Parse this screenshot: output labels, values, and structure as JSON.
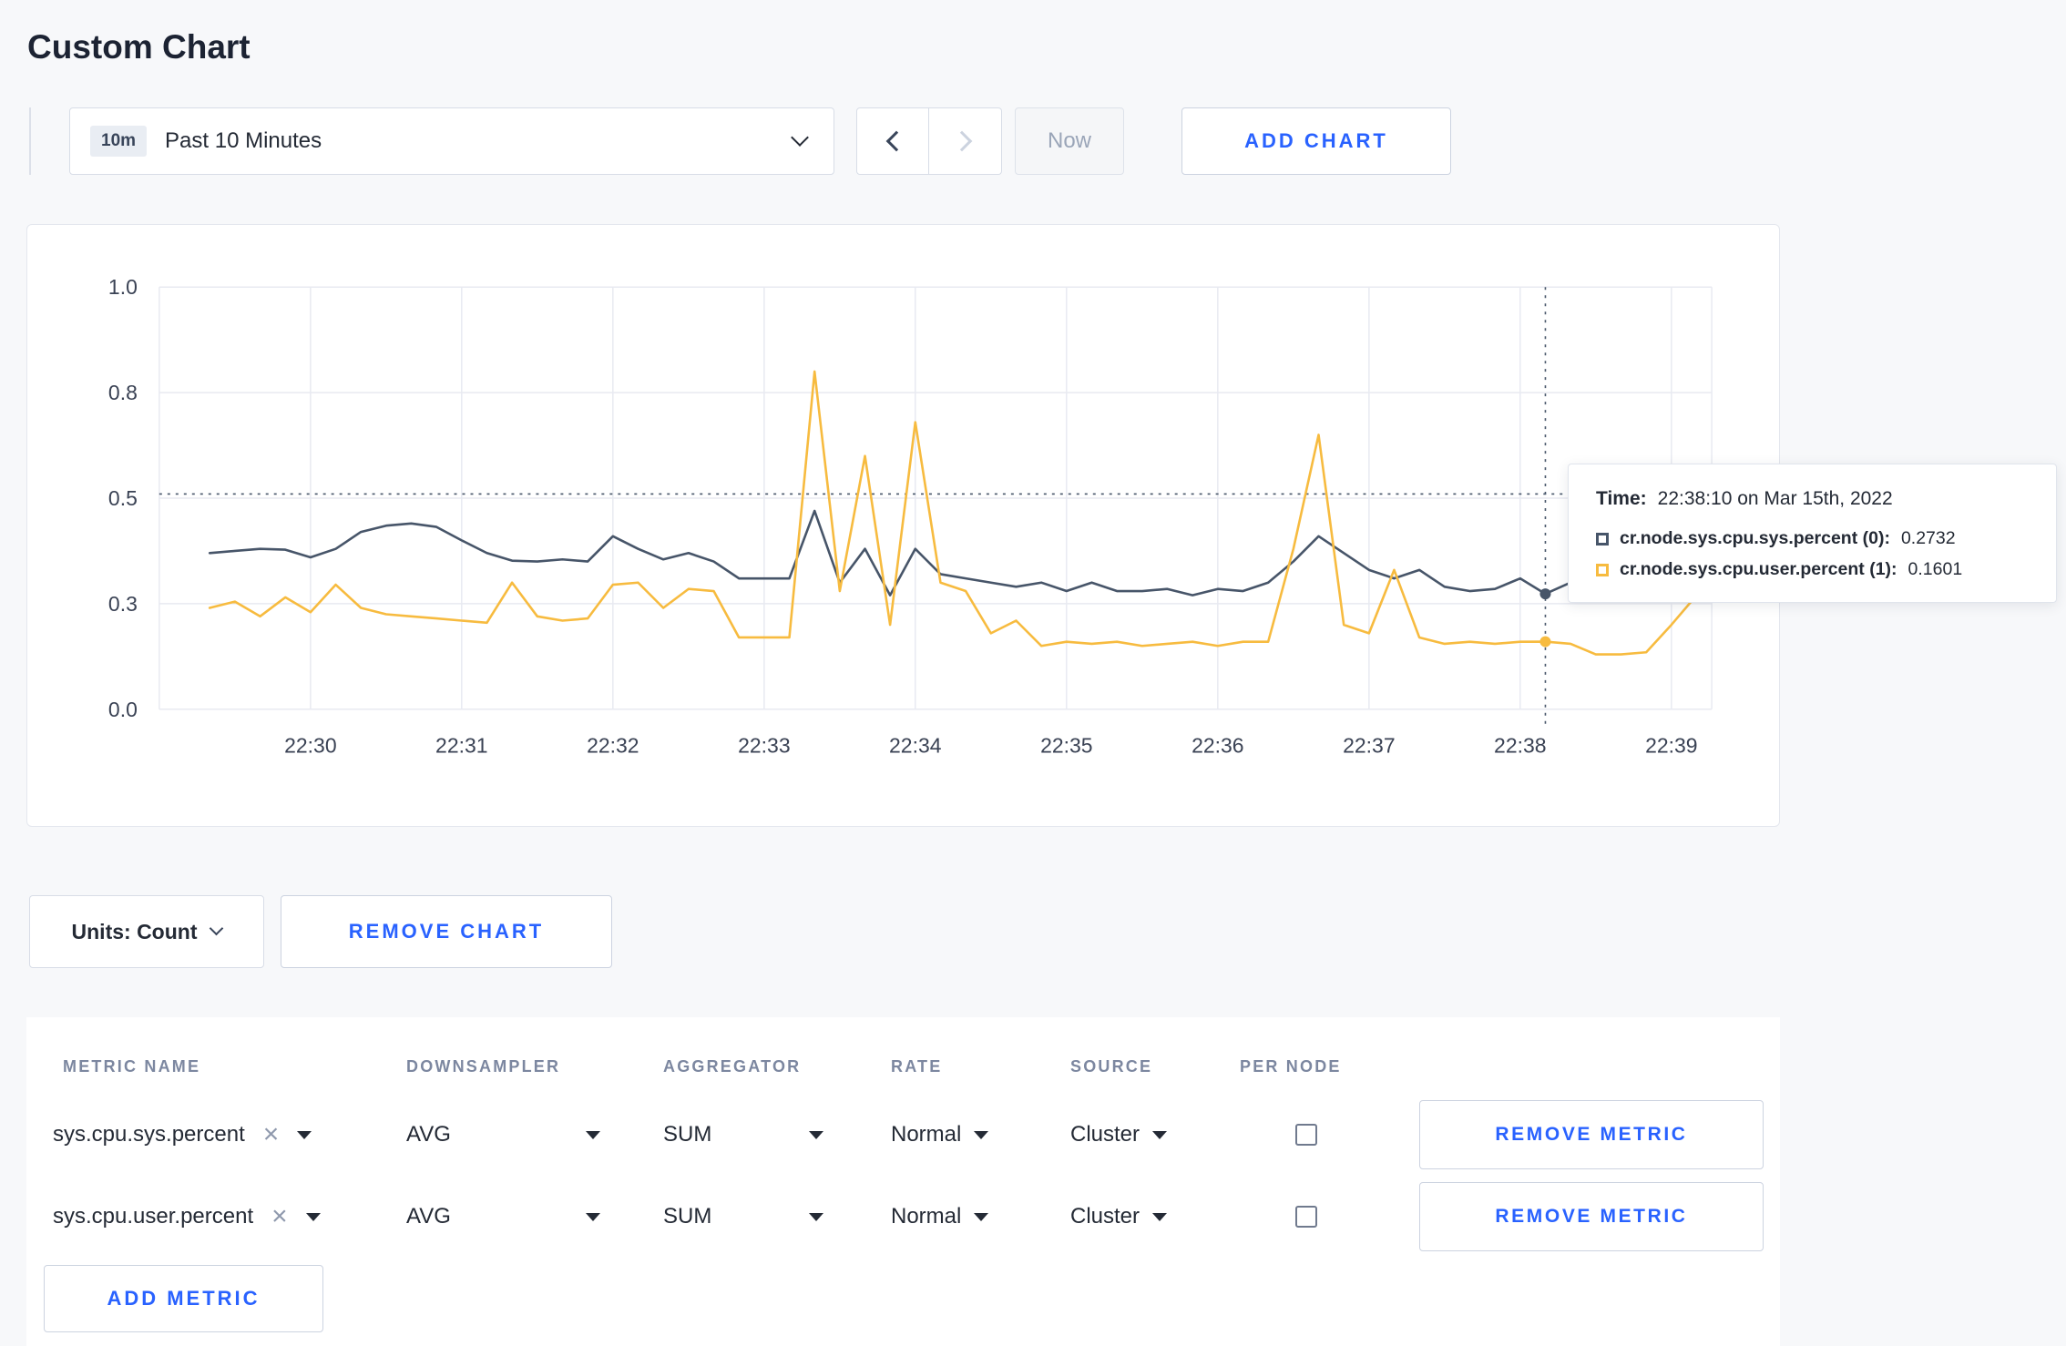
{
  "page": {
    "title": "Custom Chart"
  },
  "colors": {
    "accent_blue": "#2962ff",
    "series_sys": "#475569",
    "series_user": "#f7bb3f",
    "grid": "#e8eaf1"
  },
  "icons": {
    "close": "×",
    "chevron_down": "css-chevron-down",
    "chevron_left": "css-chevron-left",
    "chevron_right": "css-chevron-right",
    "caret_down": "css-triangle-down",
    "checkbox_unchecked": "css-box"
  },
  "toolbar": {
    "time_range": {
      "badge": "10m",
      "label": "Past 10 Minutes"
    },
    "now_label": "Now",
    "add_chart_label": "ADD CHART"
  },
  "chart_controls": {
    "units_label": "Units: Count",
    "remove_chart_label": "REMOVE CHART"
  },
  "tooltip": {
    "time_label": "Time:",
    "time_value": "22:38:10 on Mar 15th, 2022",
    "series": [
      {
        "label": "cr.node.sys.cpu.sys.percent (0):",
        "value": "0.2732"
      },
      {
        "label": "cr.node.sys.cpu.user.percent (1):",
        "value": "0.1601"
      }
    ]
  },
  "chart_data": {
    "type": "line",
    "title": "",
    "xlabel": "",
    "ylabel": "",
    "ylim": [
      0,
      1
    ],
    "grid": true,
    "legend_position": "tooltip",
    "x_domain": [
      0,
      616
    ],
    "x_unit": "seconds after 22:29:00",
    "y_ticks": [
      {
        "v": 0.0,
        "label": "0.0"
      },
      {
        "v": 0.25,
        "label": "0.3"
      },
      {
        "v": 0.5,
        "label": "0.5"
      },
      {
        "v": 0.75,
        "label": "0.8"
      },
      {
        "v": 1.0,
        "label": "1.0"
      }
    ],
    "x_ticks": [
      {
        "t": 60,
        "label": "22:30"
      },
      {
        "t": 120,
        "label": "22:31"
      },
      {
        "t": 180,
        "label": "22:32"
      },
      {
        "t": 240,
        "label": "22:33"
      },
      {
        "t": 300,
        "label": "22:34"
      },
      {
        "t": 360,
        "label": "22:35"
      },
      {
        "t": 420,
        "label": "22:36"
      },
      {
        "t": 480,
        "label": "22:37"
      },
      {
        "t": 540,
        "label": "22:38"
      },
      {
        "t": 600,
        "label": "22:39"
      }
    ],
    "crosshair": {
      "t": 550,
      "y_value": 0.51,
      "time": "22:38:10"
    },
    "series": [
      {
        "name": "cr.node.sys.cpu.sys.percent",
        "color": "#475569",
        "t_start": 20,
        "t_step": 10,
        "values": [
          0.37,
          0.375,
          0.38,
          0.378,
          0.36,
          0.38,
          0.42,
          0.435,
          0.44,
          0.432,
          0.4,
          0.37,
          0.352,
          0.35,
          0.355,
          0.35,
          0.41,
          0.38,
          0.355,
          0.37,
          0.35,
          0.31,
          0.31,
          0.31,
          0.47,
          0.3,
          0.38,
          0.27,
          0.38,
          0.32,
          0.31,
          0.3,
          0.29,
          0.3,
          0.28,
          0.3,
          0.28,
          0.28,
          0.285,
          0.27,
          0.285,
          0.28,
          0.3,
          0.35,
          0.41,
          0.37,
          0.33,
          0.31,
          0.33,
          0.29,
          0.28,
          0.285,
          0.31,
          0.2732,
          0.3,
          0.29,
          0.28,
          0.29,
          0.3,
          0.29
        ]
      },
      {
        "name": "cr.node.sys.cpu.user.percent",
        "color": "#f7bb3f",
        "t_start": 20,
        "t_step": 10,
        "values": [
          0.24,
          0.255,
          0.22,
          0.265,
          0.23,
          0.295,
          0.24,
          0.225,
          0.22,
          0.215,
          0.21,
          0.205,
          0.3,
          0.22,
          0.21,
          0.215,
          0.295,
          0.3,
          0.24,
          0.285,
          0.28,
          0.17,
          0.17,
          0.17,
          0.8,
          0.28,
          0.6,
          0.2,
          0.68,
          0.3,
          0.28,
          0.18,
          0.21,
          0.15,
          0.16,
          0.155,
          0.16,
          0.15,
          0.155,
          0.16,
          0.15,
          0.16,
          0.16,
          0.38,
          0.65,
          0.2,
          0.18,
          0.33,
          0.17,
          0.155,
          0.16,
          0.155,
          0.16,
          0.1601,
          0.155,
          0.13,
          0.13,
          0.135,
          0.2,
          0.27
        ]
      }
    ]
  },
  "metrics_table": {
    "headers": [
      "METRIC NAME",
      "DOWNSAMPLER",
      "AGGREGATOR",
      "RATE",
      "SOURCE",
      "PER NODE"
    ],
    "rows": [
      {
        "metric_name": "sys.cpu.sys.percent",
        "downsampler": "AVG",
        "aggregator": "SUM",
        "rate": "Normal",
        "source": "Cluster",
        "per_node": false
      },
      {
        "metric_name": "sys.cpu.user.percent",
        "downsampler": "AVG",
        "aggregator": "SUM",
        "rate": "Normal",
        "source": "Cluster",
        "per_node": false
      }
    ],
    "remove_metric_label": "REMOVE METRIC",
    "add_metric_label": "ADD METRIC"
  }
}
